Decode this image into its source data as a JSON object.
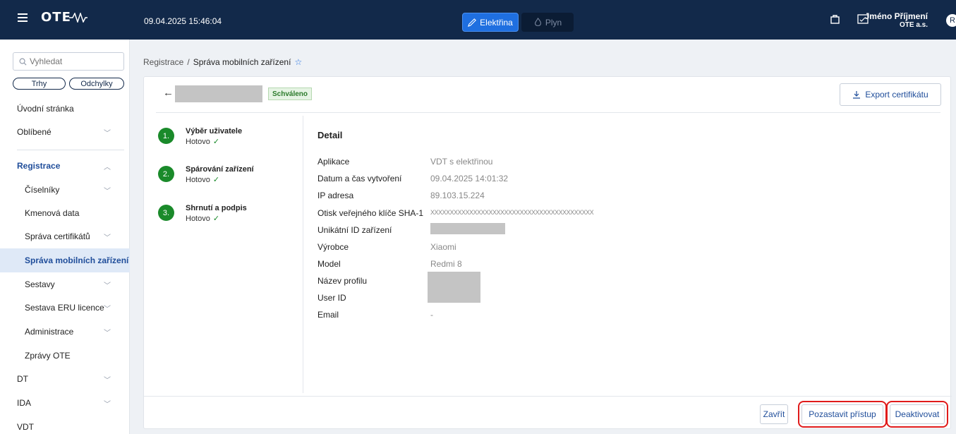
{
  "header": {
    "logo": "OTE",
    "datetime": "09.04.2025 15:46:04",
    "commodities": [
      {
        "label": "Elektřina",
        "active": true
      },
      {
        "label": "Plyn",
        "active": false
      }
    ],
    "user_name": "Jméno Příjmení",
    "user_org": "OTE a.s.",
    "avatar": "R"
  },
  "sidebar": {
    "search_placeholder": "Vyhledat",
    "pills": [
      "Trhy",
      "Odchylky"
    ],
    "items": [
      {
        "label": "Úvodní stránka"
      },
      {
        "label": "Oblíbené",
        "chevron": "﹀"
      },
      {
        "label": "Registrace",
        "chevron": "︿"
      },
      {
        "label": "Číselníky",
        "chevron": "﹀"
      },
      {
        "label": "Kmenová data"
      },
      {
        "label": "Správa certifikátů",
        "chevron": "﹀"
      },
      {
        "label": "Správa mobilních zařízení"
      },
      {
        "label": "Sestavy",
        "chevron": "﹀"
      },
      {
        "label": "Sestava ERU licence",
        "chevron": "﹀"
      },
      {
        "label": "Administrace",
        "chevron": "﹀"
      },
      {
        "label": "Zprávy OTE"
      },
      {
        "label": "DT",
        "chevron": "﹀"
      },
      {
        "label": "IDA",
        "chevron": "﹀"
      },
      {
        "label": "VDT"
      }
    ]
  },
  "breadcrumb": {
    "parent": "Registrace",
    "separator": "/",
    "current": "Správa mobilních zařízení"
  },
  "panel": {
    "status": "Schváleno",
    "export_label": "Export certifikátu",
    "steps": [
      {
        "number": "1.",
        "title": "Výběr uživatele",
        "state": "Hotovo"
      },
      {
        "number": "2.",
        "title": "Spárování zařízení",
        "state": "Hotovo"
      },
      {
        "number": "3.",
        "title": "Shrnutí a podpis",
        "state": "Hotovo"
      }
    ],
    "detail_title": "Detail",
    "fields": [
      {
        "key": "Aplikace",
        "value": "VDT s elektřinou"
      },
      {
        "key": "Datum a čas vytvoření",
        "value": "09.04.2025 14:01:32"
      },
      {
        "key": "IP adresa",
        "value": "89.103.15.224"
      },
      {
        "key": "Otisk veřejného klíče SHA-1",
        "value": "XXXXXXXXXXXXXXXXXXXXXXXXXXXXXXXXXXXXXXXXXX"
      },
      {
        "key": "Unikátní ID zařízení",
        "value": ""
      },
      {
        "key": "Výrobce",
        "value": "Xiaomi"
      },
      {
        "key": "Model",
        "value": "Redmi 8"
      },
      {
        "key": "Název profilu",
        "value": ""
      },
      {
        "key": "User ID",
        "value": ""
      },
      {
        "key": "Email",
        "value": "-"
      }
    ],
    "buttons": {
      "close": "Zavřít",
      "pause": "Pozastavit přístup",
      "deactivate": "Deaktivovat"
    }
  },
  "colors": {
    "topbar": "#12294a",
    "accent": "#1f6fe0",
    "success": "#1a8a2a",
    "highlight": "#e01b1b"
  }
}
